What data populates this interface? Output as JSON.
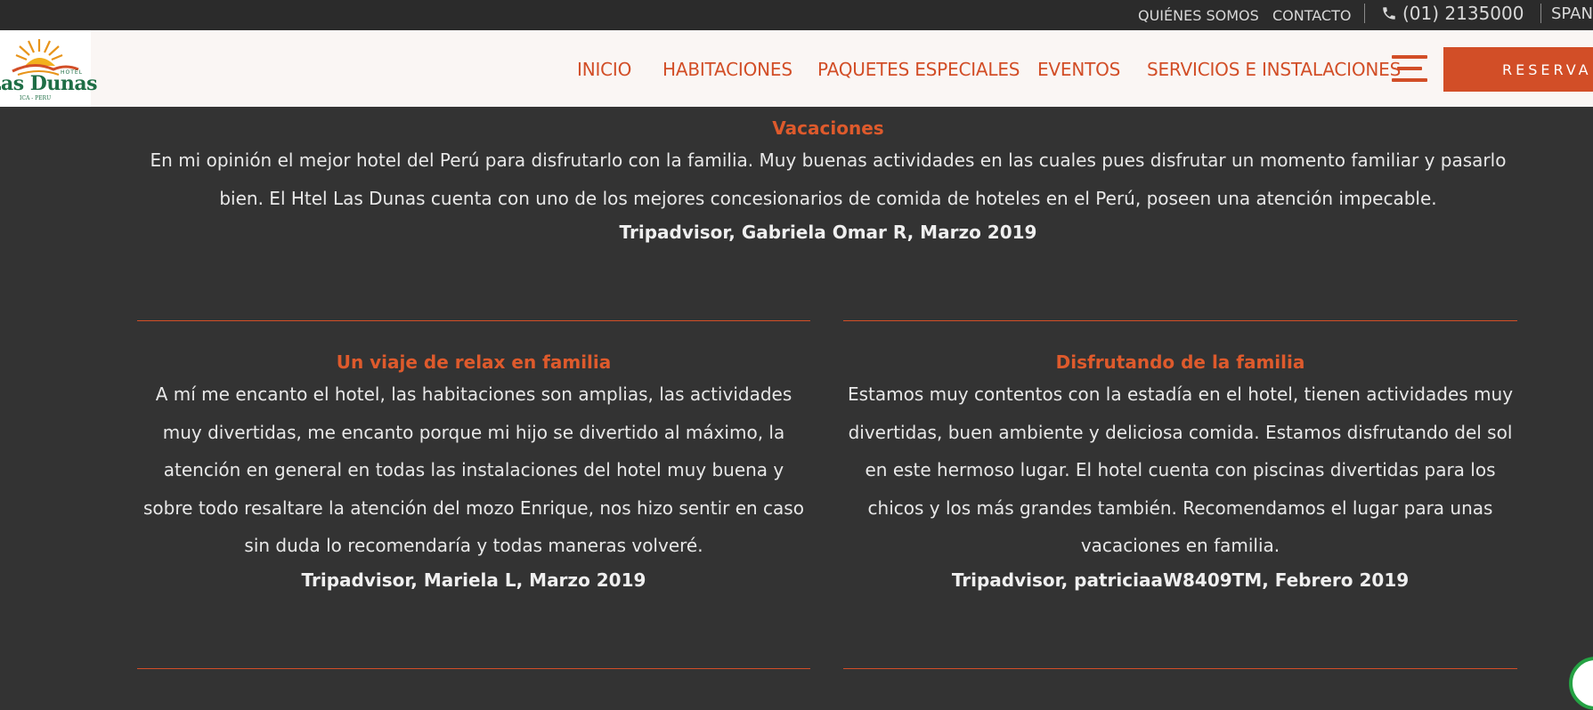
{
  "topbar": {
    "quienes_somos": "QUIÉNES SOMOS",
    "contacto": "CONTACTO",
    "phone": "(01) 2135000",
    "language": "SPAN"
  },
  "header": {
    "logo": {
      "brand": "Las Dunas",
      "tag": "HOTEL",
      "location": "ICA - PERU"
    },
    "nav": {
      "inicio": "INICIO",
      "habitaciones": "HABITACIONES",
      "paquetes": "PAQUETES ESPECIALES",
      "eventos": "EVENTOS",
      "servicios": "SERVICIOS E INSTALACIONES"
    },
    "reserve_label": "RESERVAR"
  },
  "reviews": [
    {
      "title": "Vacaciones",
      "text": "En mi opinión el mejor hotel del Perú para disfrutarlo con la familia. Muy buenas actividades en las cuales pues disfrutar un momento familiar y pasarlo bien. El Htel Las Dunas cuenta con uno de los mejores concesionarios de comida de hoteles en el Perú, poseen una atención impecable.",
      "author": "Tripadvisor, Gabriela Omar R, Marzo 2019"
    },
    {
      "title": "Un viaje de relax en familia",
      "text": "A mí me encanto el hotel, las habitaciones son amplias, las actividades muy divertidas, me encanto porque mi hijo se divertido al máximo, la atención en general en todas las instalaciones del hotel muy buena y sobre todo resaltare la atención del mozo Enrique, nos hizo sentir en caso sin duda lo recomendaría y todas maneras volveré.",
      "author": "Tripadvisor, Mariela L, Marzo 2019"
    },
    {
      "title": "Disfrutando de la familia",
      "text": "Estamos muy contentos con la estadía en el hotel, tienen actividades muy divertidas, buen ambiente y deliciosa comida. Estamos disfrutando del sol en este hermoso lugar. El hotel cuenta con piscinas divertidas para los chicos y los más grandes también. Recomendamos el lugar para unas vacaciones en familia.",
      "author": "Tripadvisor, patriciaaW8409TM, Febrero 2019"
    }
  ],
  "colors": {
    "accent": "#d24e27",
    "background": "#333333",
    "topbar": "#2b2b2b",
    "header": "#faf6f4"
  },
  "icons": {
    "phone": "phone-icon",
    "menu": "hamburger-menu-icon",
    "chat": "whatsapp-chat-icon"
  }
}
